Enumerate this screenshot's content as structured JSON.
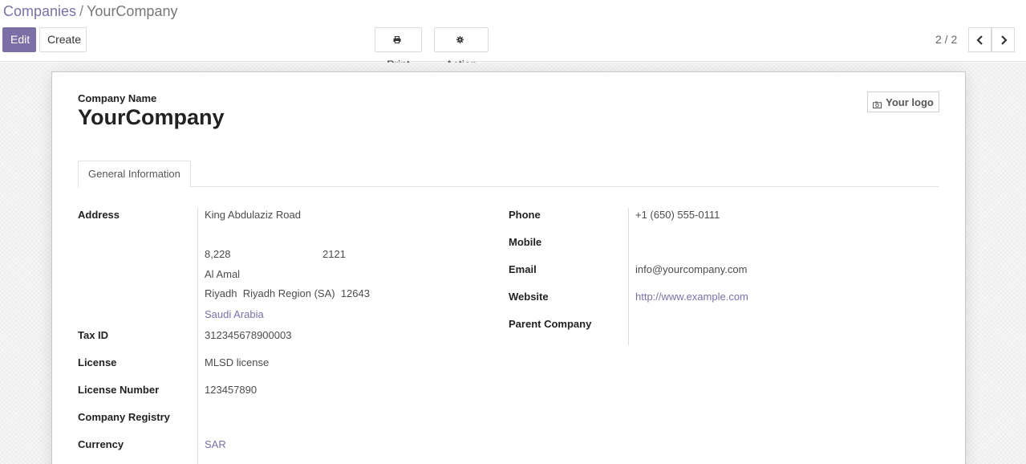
{
  "breadcrumb": {
    "parent": "Companies",
    "separator": "/",
    "current": "YourCompany"
  },
  "toolbar": {
    "edit_label": "Edit",
    "create_label": "Create",
    "print_label": "Print",
    "action_label": "Action"
  },
  "pager": {
    "value": "2 / 2"
  },
  "form": {
    "company_name_label": "Company Name",
    "company_name": "YourCompany",
    "logo_label": "Your logo",
    "tab_label": "General Information",
    "address": {
      "label": "Address",
      "street": "King Abdulaziz Road",
      "building_no": "8,228",
      "additional_no": "2121",
      "district": "Al Amal",
      "city": "Riyadh",
      "state": "Riyadh Region (SA)",
      "zip": "12643",
      "country": "Saudi Arabia"
    },
    "tax_id": {
      "label": "Tax ID",
      "value": "312345678900003"
    },
    "license": {
      "label": "License",
      "value": "MLSD license"
    },
    "license_number": {
      "label": "License Number",
      "value": "123457890"
    },
    "company_registry": {
      "label": "Company Registry",
      "value": ""
    },
    "currency": {
      "label": "Currency",
      "value": "SAR"
    },
    "phone": {
      "label": "Phone",
      "value": "+1 (650) 555-0111"
    },
    "mobile": {
      "label": "Mobile",
      "value": ""
    },
    "email": {
      "label": "Email",
      "value": "info@yourcompany.com"
    },
    "website": {
      "label": "Website",
      "value": "http://www.example.com"
    },
    "parent_company": {
      "label": "Parent Company",
      "value": ""
    }
  },
  "icons": {
    "print": "printer-icon",
    "action": "gear-icon",
    "prev": "chevron-left-icon",
    "next": "chevron-right-icon",
    "logo": "camera-icon"
  },
  "colors": {
    "primary": "#7c6fa8",
    "link": "#7c6fa8"
  }
}
